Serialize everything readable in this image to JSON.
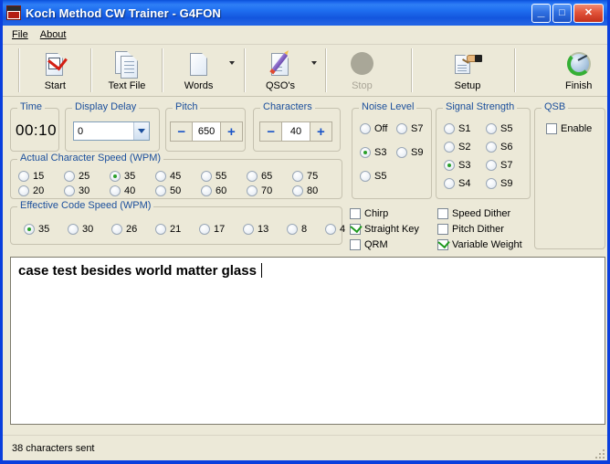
{
  "window": {
    "title": "Koch Method CW Trainer - G4FON",
    "icon": "g4fon-app-icon",
    "controls": {
      "minimize": "_",
      "maximize": "□",
      "close": "✕"
    }
  },
  "menubar": {
    "items": [
      {
        "label": "File",
        "accel": "F"
      },
      {
        "label": "About",
        "accel": "A"
      }
    ]
  },
  "toolbar": {
    "buttons": [
      {
        "label": "Start",
        "icon": "page-checkmark-icon",
        "enabled": true,
        "dropdown": false
      },
      {
        "label": "Text File",
        "icon": "pages-stack-icon",
        "enabled": true,
        "dropdown": false
      },
      {
        "label": "Words",
        "icon": "page-blank-icon",
        "enabled": true,
        "dropdown": true
      },
      {
        "label": "QSO's",
        "icon": "page-pencil-icon",
        "enabled": true,
        "dropdown": true
      },
      {
        "label": "Stop",
        "icon": "stop-circle-icon",
        "enabled": false,
        "dropdown": false
      },
      {
        "label": "Setup",
        "icon": "hand-writing-icon",
        "enabled": true,
        "dropdown": false
      },
      {
        "label": "Finish",
        "icon": "green-refresh-clock-icon",
        "enabled": true,
        "dropdown": false
      }
    ]
  },
  "time": {
    "legend": "Time",
    "value": "00:10"
  },
  "display_delay": {
    "legend": "Display Delay",
    "value": "0"
  },
  "pitch": {
    "legend": "Pitch",
    "value": "650",
    "decrement": "−",
    "increment": "+"
  },
  "characters": {
    "legend": "Characters",
    "value": "40",
    "decrement": "−",
    "increment": "+"
  },
  "noise_level": {
    "legend": "Noise Level",
    "options": [
      {
        "label": "Off",
        "selected": false
      },
      {
        "label": "S7",
        "selected": false
      },
      {
        "label": "S3",
        "selected": true
      },
      {
        "label": "S9",
        "selected": false
      },
      {
        "label": "S5",
        "selected": false
      }
    ]
  },
  "signal_strength": {
    "legend": "Signal Strength",
    "options": [
      {
        "label": "S1",
        "selected": false
      },
      {
        "label": "S5",
        "selected": false
      },
      {
        "label": "S2",
        "selected": false
      },
      {
        "label": "S6",
        "selected": false
      },
      {
        "label": "S3",
        "selected": true
      },
      {
        "label": "S7",
        "selected": false
      },
      {
        "label": "S4",
        "selected": false
      },
      {
        "label": "S9",
        "selected": false
      }
    ]
  },
  "qsb": {
    "legend": "QSB",
    "enable": {
      "label": "Enable",
      "checked": false
    }
  },
  "actual_character_speed": {
    "legend": "Actual Character Speed (WPM)",
    "options": [
      {
        "label": "15",
        "selected": false
      },
      {
        "label": "20",
        "selected": false
      },
      {
        "label": "25",
        "selected": false
      },
      {
        "label": "30",
        "selected": false
      },
      {
        "label": "35",
        "selected": true
      },
      {
        "label": "40",
        "selected": false
      },
      {
        "label": "45",
        "selected": false
      },
      {
        "label": "50",
        "selected": false
      },
      {
        "label": "55",
        "selected": false
      },
      {
        "label": "60",
        "selected": false
      },
      {
        "label": "65",
        "selected": false
      },
      {
        "label": "70",
        "selected": false
      },
      {
        "label": "75",
        "selected": false
      },
      {
        "label": "80",
        "selected": false
      }
    ]
  },
  "effective_code_speed": {
    "legend": "Effective Code Speed (WPM)",
    "options": [
      {
        "label": "35",
        "selected": true
      },
      {
        "label": "30",
        "selected": false
      },
      {
        "label": "26",
        "selected": false
      },
      {
        "label": "21",
        "selected": false
      },
      {
        "label": "17",
        "selected": false
      },
      {
        "label": "13",
        "selected": false
      },
      {
        "label": "8",
        "selected": false
      },
      {
        "label": "4",
        "selected": false
      }
    ]
  },
  "effects": {
    "options": [
      {
        "label": "Chirp",
        "checked": false
      },
      {
        "label": "Straight Key",
        "checked": true
      },
      {
        "label": "QRM",
        "checked": false
      },
      {
        "label": "Speed Dither",
        "checked": false
      },
      {
        "label": "Pitch Dither",
        "checked": false
      },
      {
        "label": "Variable Weight",
        "checked": true
      }
    ]
  },
  "output": {
    "text": "case test besides world matter glass "
  },
  "statusbar": {
    "text": "38 characters sent"
  },
  "colors": {
    "title_blue": "#1f6ff0",
    "window_border": "#0a3fdd",
    "face": "#ece9d8",
    "legend_blue": "#1b4f9c",
    "radio_green": "#2aa02a",
    "check_green": "#1f9a1f",
    "close_red": "#c3301b"
  }
}
